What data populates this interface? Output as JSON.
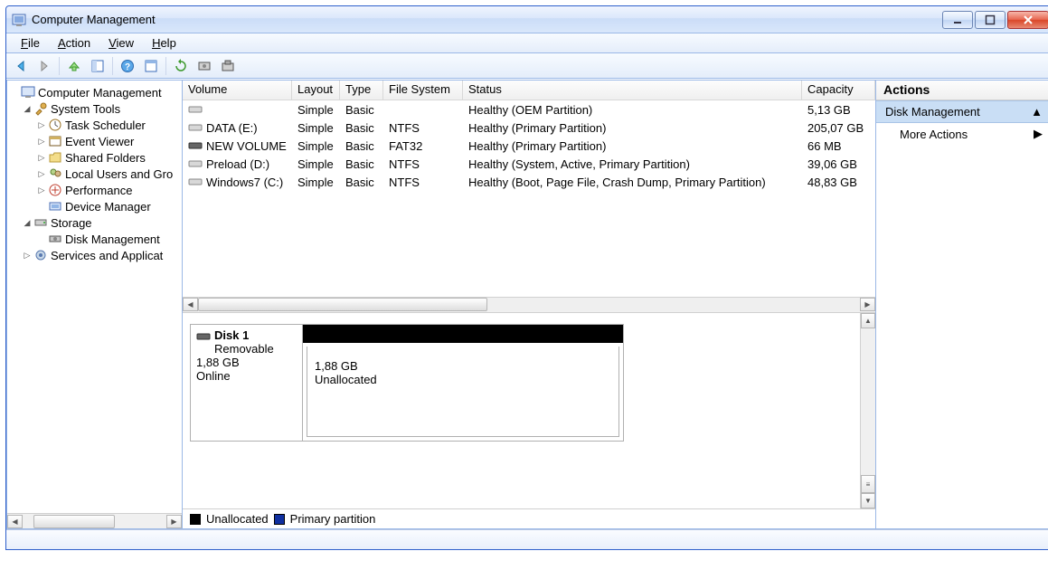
{
  "window": {
    "title": "Computer Management"
  },
  "menu": {
    "file": "File",
    "action": "Action",
    "view": "View",
    "help": "Help"
  },
  "tree": {
    "root": "Computer Management",
    "systools": "System Tools",
    "systools_items": [
      "Task Scheduler",
      "Event Viewer",
      "Shared Folders",
      "Local Users and Gro",
      "Performance",
      "Device Manager"
    ],
    "storage": "Storage",
    "diskmgmt": "Disk Management",
    "services": "Services and Applicat"
  },
  "vol": {
    "headers": [
      "Volume",
      "Layout",
      "Type",
      "File System",
      "Status",
      "Capacity"
    ],
    "rows": [
      {
        "name": "",
        "layout": "Simple",
        "type": "Basic",
        "fs": "",
        "status": "Healthy (OEM Partition)",
        "cap": "5,13 GB"
      },
      {
        "name": "DATA (E:)",
        "layout": "Simple",
        "type": "Basic",
        "fs": "NTFS",
        "status": "Healthy (Primary Partition)",
        "cap": "205,07 GB"
      },
      {
        "name": "NEW VOLUME",
        "layout": "Simple",
        "type": "Basic",
        "fs": "FAT32",
        "status": "Healthy (Primary Partition)",
        "cap": "66 MB"
      },
      {
        "name": "Preload (D:)",
        "layout": "Simple",
        "type": "Basic",
        "fs": "NTFS",
        "status": "Healthy (System, Active, Primary Partition)",
        "cap": "39,06 GB"
      },
      {
        "name": "Windows7 (C:)",
        "layout": "Simple",
        "type": "Basic",
        "fs": "NTFS",
        "status": "Healthy (Boot, Page File, Crash Dump, Primary Partition)",
        "cap": "48,83 GB"
      }
    ]
  },
  "disk": {
    "title": "Disk 1",
    "kind": "Removable",
    "size": "1,88 GB",
    "state": "Online",
    "part_size": "1,88 GB",
    "part_state": "Unallocated"
  },
  "legend": {
    "unalloc": "Unallocated",
    "primary": "Primary partition"
  },
  "actions": {
    "header": "Actions",
    "title": "Disk Management",
    "more": "More Actions"
  }
}
